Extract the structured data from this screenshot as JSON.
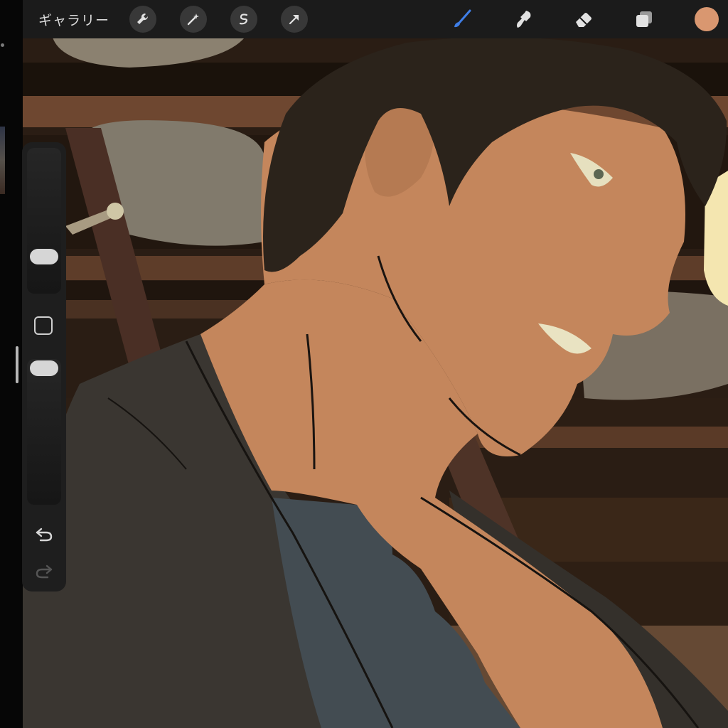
{
  "app": {
    "gallery_label": "ギャラリー"
  },
  "toolbar": {
    "left_tools": [
      "wrench-icon",
      "magic-wand-icon",
      "selection-icon",
      "transform-arrow-icon"
    ],
    "right_tools": [
      "brush-icon",
      "smudge-icon",
      "eraser-icon",
      "layers-icon"
    ],
    "active_tool": "brush-icon",
    "current_color": "#d99770"
  },
  "sidebar": {
    "brush_size_level": 0.35,
    "opacity_level": 1.0,
    "controls": [
      "brush-size-slider",
      "modify-button",
      "opacity-slider",
      "undo-icon",
      "redo-icon"
    ]
  },
  "colors": {
    "toolbar_bg": "#1b1b1b",
    "tool_button_bg": "#383838",
    "active_tool": "#3f7ee6",
    "icon": "#e2e2e2",
    "skin": "#c4865c",
    "hair": "#2b231b",
    "shirt": "#3a3631",
    "undershirt": "#434c52"
  }
}
